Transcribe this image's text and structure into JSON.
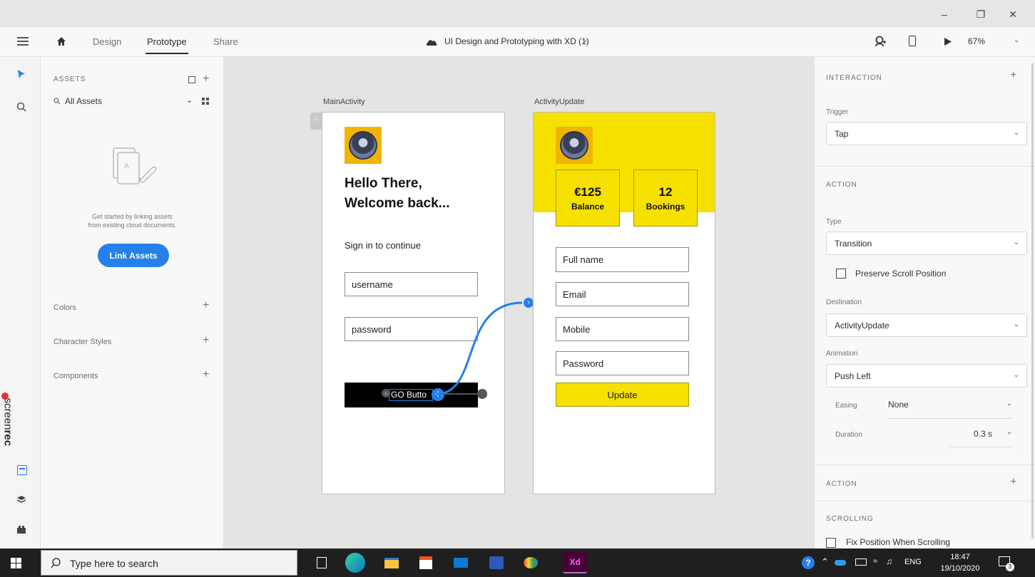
{
  "window": {
    "minimize": "–",
    "restore": "❐",
    "close": "✕"
  },
  "appbar": {
    "tabs": [
      "Design",
      "Prototype",
      "Share"
    ],
    "doc_title": "UI Design and Prototyping with XD (1)",
    "zoom": "67%"
  },
  "assets": {
    "heading": "ASSETS",
    "filter": "All Assets",
    "empty_text_1": "Get started by linking assets",
    "empty_text_2": "from existing cloud documents.",
    "link_button": "Link Assets",
    "sections": [
      "Colors",
      "Character Styles",
      "Components"
    ]
  },
  "screenrec": {
    "text_a": "screen",
    "text_b": "rec"
  },
  "main_activity": {
    "label": "MainActivity",
    "greeting_1": "Hello There,",
    "greeting_2": "Welcome back...",
    "subtitle": "Sign in to continue",
    "username": "username",
    "password": "password",
    "go_button": "GO Butto"
  },
  "activity_update": {
    "label": "ActivityUpdate",
    "balance_value": "€125",
    "balance_label": "Balance",
    "bookings_value": "12",
    "bookings_label": "Bookings",
    "fields": [
      "Full name",
      "Email",
      "Mobile",
      "Password"
    ],
    "update_button": "Update"
  },
  "props": {
    "interaction_title": "INTERACTION",
    "trigger_label": "Trigger",
    "trigger_value": "Tap",
    "action_title": "ACTION",
    "type_label": "Type",
    "type_value": "Transition",
    "preserve_scroll": "Preserve Scroll Position",
    "destination_label": "Destination",
    "destination_value": "ActivityUpdate",
    "animation_label": "Animation",
    "animation_value": "Push Left",
    "easing_label": "Easing",
    "easing_value": "None",
    "duration_label": "Duration",
    "duration_value": "0.3 s",
    "action2_title": "ACTION",
    "scrolling_title": "SCROLLING",
    "fix_position": "Fix Position When Scrolling"
  },
  "taskbar": {
    "search_placeholder": "Type here to search",
    "xd_label": "Xd",
    "lang": "ENG",
    "time": "18:47",
    "date": "19/10/2020",
    "notif_count": "3"
  },
  "colors": {
    "accent_blue": "#2680eb",
    "yellow": "#f5e000",
    "xd_purple": "#470137"
  }
}
